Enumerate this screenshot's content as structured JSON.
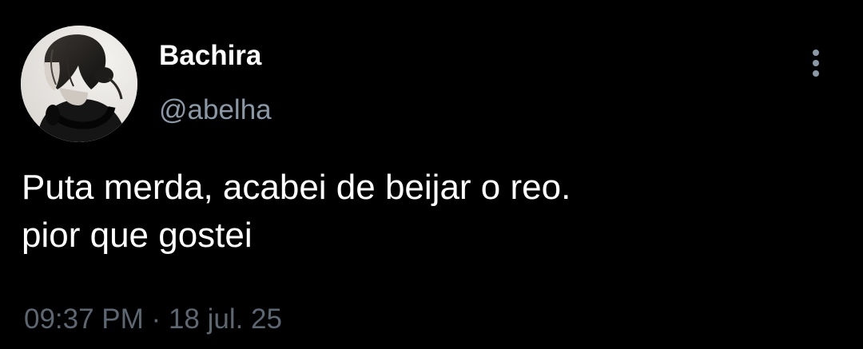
{
  "tweet": {
    "author": {
      "display_name": "Bachira",
      "handle": "@abelha",
      "avatar_icon": "profile-photo"
    },
    "text_lines": [
      "Puta merda, acabei de beijar o reo.",
      "pior que gostei"
    ],
    "time": "09:37 PM",
    "separator": "·",
    "date": "18 jul. 25",
    "more_icon": "more-vertical-icon"
  },
  "colors": {
    "background": "#000000",
    "text_primary": "#ffffff",
    "text_secondary": "#8b98a5",
    "text_meta": "#5c6772"
  }
}
